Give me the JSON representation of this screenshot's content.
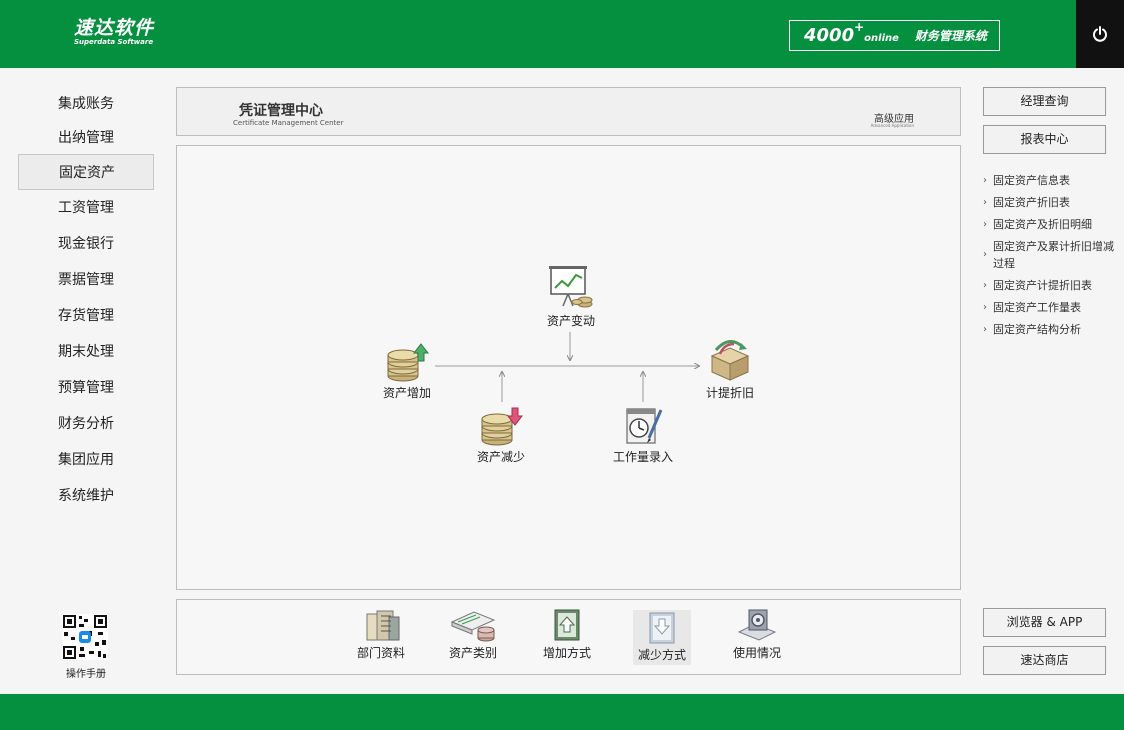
{
  "header": {
    "logo_cn": "速达软件",
    "logo_en": "Superdata Software",
    "brand": "4000",
    "brand_plus": "+",
    "brand_online": "online",
    "system_name": "财务管理系统"
  },
  "left_nav": {
    "items": [
      {
        "label": "集成账务"
      },
      {
        "label": "出纳管理"
      },
      {
        "label": "固定资产"
      },
      {
        "label": "工资管理"
      },
      {
        "label": "现金银行"
      },
      {
        "label": "票据管理"
      },
      {
        "label": "存货管理"
      },
      {
        "label": "期末处理"
      },
      {
        "label": "预算管理"
      },
      {
        "label": "财务分析"
      },
      {
        "label": "集团应用"
      },
      {
        "label": "系统维护"
      }
    ],
    "active": "固定资产",
    "manual_label": "操作手册"
  },
  "title_bar": {
    "title_cn": "凭证管理中心",
    "title_en": "Certificate Management Center",
    "advanced_cn": "高级应用",
    "advanced_en": "Advanced Application"
  },
  "flow": {
    "asset_change": "资产变动",
    "asset_increase": "资产增加",
    "asset_decrease": "资产减少",
    "workload_entry": "工作量录入",
    "depreciation": "计提折旧"
  },
  "toolbar": {
    "items": [
      {
        "label": "部门资料",
        "icon": "department-icon"
      },
      {
        "label": "资产类别",
        "icon": "asset-category-icon"
      },
      {
        "label": "增加方式",
        "icon": "add-method-icon"
      },
      {
        "label": "减少方式",
        "icon": "reduce-method-icon"
      },
      {
        "label": "使用情况",
        "icon": "usage-icon"
      }
    ]
  },
  "right_panel": {
    "manager_query": "经理查询",
    "report_center": "报表中心",
    "reports": [
      "固定资产信息表",
      "固定资产折旧表",
      "固定资产及折旧明细",
      "固定资产及累计折旧增减过程",
      "固定资产计提折旧表",
      "固定资产工作量表",
      "固定资产结构分析"
    ],
    "browser_app": "浏览器 & APP",
    "store": "速达商店"
  },
  "colors": {
    "brand_green": "#059040",
    "power_bg": "#111111"
  }
}
